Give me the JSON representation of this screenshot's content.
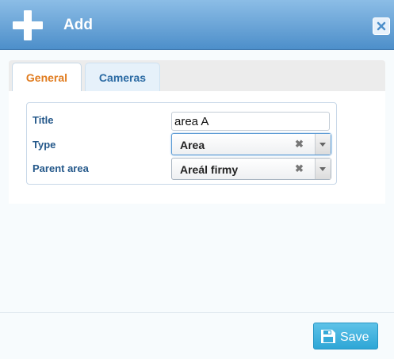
{
  "dialog": {
    "title": "Add",
    "icon": "plus-icon",
    "close_icon": "close-icon"
  },
  "tabs": [
    {
      "label": "General",
      "active": true
    },
    {
      "label": "Cameras",
      "active": false
    }
  ],
  "form": {
    "title": {
      "label": "Title",
      "value": "area A"
    },
    "type": {
      "label": "Type",
      "value": "Area"
    },
    "parent_area": {
      "label": "Parent area",
      "value": "Areál firmy"
    }
  },
  "footer": {
    "save_label": "Save",
    "save_icon": "floppy-disk-icon"
  },
  "colors": {
    "header": "#4d8fca",
    "active_tab": "#e07b1e",
    "label": "#24588a",
    "save": "#2ea6d6"
  }
}
